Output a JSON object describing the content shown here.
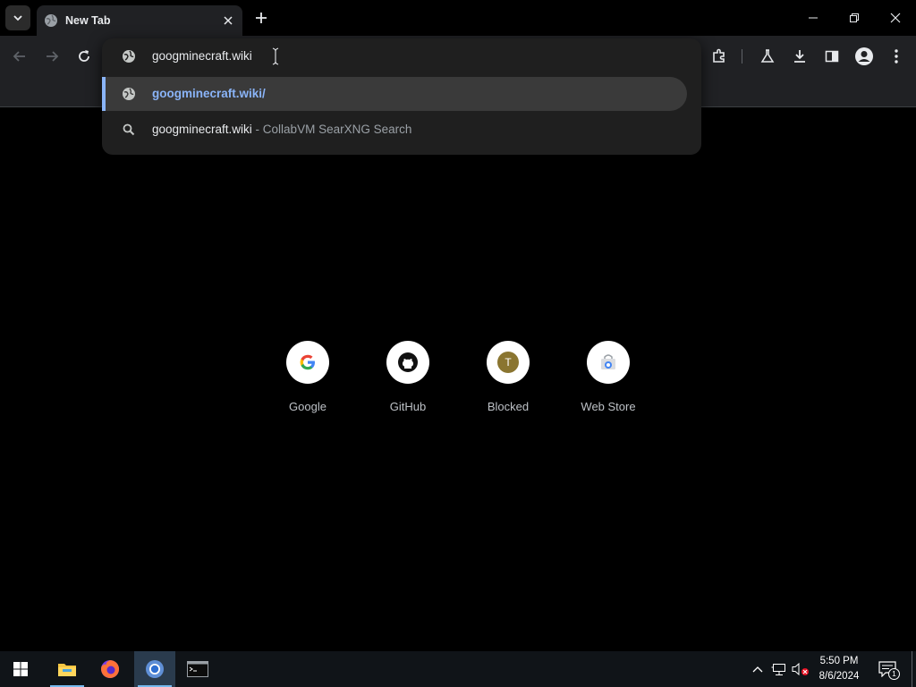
{
  "tabs": [
    {
      "title": "New Tab"
    }
  ],
  "omnibox": {
    "input_value": "googminecraft.wiki",
    "suggestions": [
      {
        "text": "googminecraft.wiki/",
        "type": "url"
      },
      {
        "text": "googminecraft.wiki",
        "separator": " - ",
        "description": "CollabVM SearXNG Search",
        "type": "search"
      }
    ]
  },
  "shortcuts": [
    {
      "label": "Google",
      "icon": "google-icon"
    },
    {
      "label": "GitHub",
      "icon": "github-icon"
    },
    {
      "label": "Blocked",
      "icon": "letter-t-icon",
      "letter": "T"
    },
    {
      "label": "Web Store",
      "icon": "web-store-icon"
    }
  ],
  "taskbar": {
    "time": "5:50 PM",
    "date": "8/6/2024",
    "notification_count": "1"
  },
  "colors": {
    "accent": "#8ab4f8",
    "toolbar_bg": "#202124",
    "page_bg": "#000000",
    "taskbar_bg": "#101418"
  }
}
